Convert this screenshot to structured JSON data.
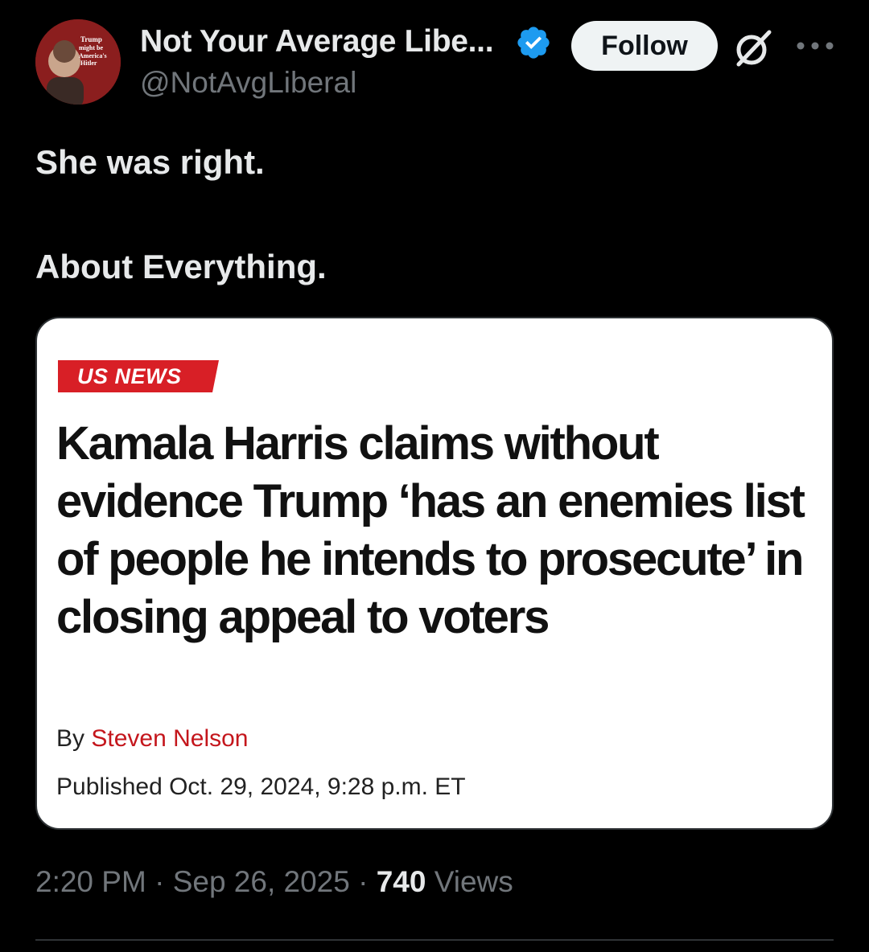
{
  "author": {
    "display_name": "Not Your Average Libe...",
    "handle": "@NotAvgLiberal",
    "avatar_text": [
      "Trump",
      "might be",
      "America's",
      "Hitler"
    ],
    "verified_color": "#1d9bf0"
  },
  "header": {
    "follow_label": "Follow",
    "grok_icon": "grok-icon",
    "more_icon": "more-icon"
  },
  "tweet": {
    "lines": [
      "She was right.",
      "About Everything."
    ]
  },
  "card": {
    "tag": "US NEWS",
    "headline": "Kamala Harris claims without evidence Trump ‘has an enemies list of people he intends to prosecute’ in closing appeal to voters",
    "byline_prefix": "By ",
    "author": "Steven Nelson",
    "published": "Published Oct. 29, 2024, 9:28 p.m. ET",
    "tag_color": "#d81f26"
  },
  "meta": {
    "time": "2:20 PM",
    "separator": " · ",
    "date": "Sep 26, 2025",
    "views_count": "740",
    "views_label": " Views"
  }
}
